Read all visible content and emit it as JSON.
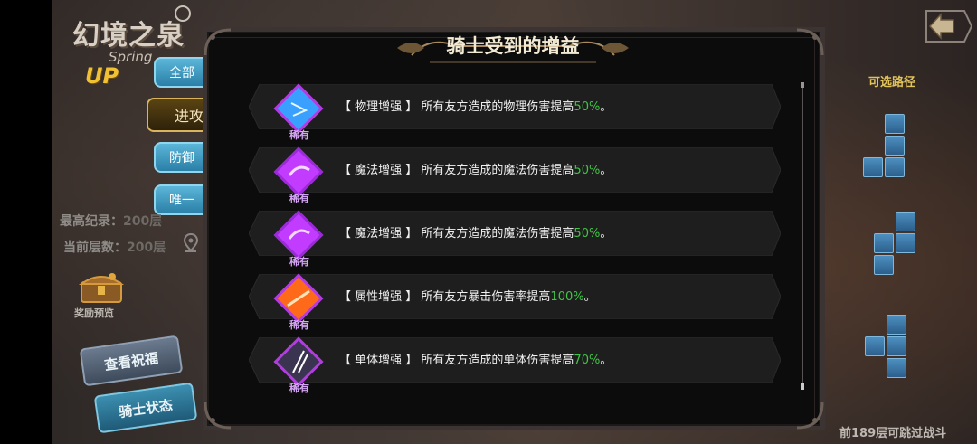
{
  "logo": {
    "title_cn": "幻境之泉",
    "title_en": "Spring",
    "badge": "UP"
  },
  "filter_tabs": [
    {
      "label": "全部"
    },
    {
      "label": "进攻"
    },
    {
      "label": "防御"
    },
    {
      "label": "唯一"
    }
  ],
  "stats": {
    "best_label": "最高纪录：",
    "best_value": "200层",
    "current_label": "当前层数：",
    "current_value": "200层"
  },
  "reward_preview": "奖励预览",
  "buttons": {
    "view_blessing": "查看祝福",
    "knight_status": "骑士状态"
  },
  "right_panel": {
    "path_title": "可选路径",
    "footer_note": "前189层可跳过战斗"
  },
  "modal": {
    "title": "骑士受到的增益",
    "buffs": [
      {
        "name": "【 物理增强 】",
        "desc": "所有友方造成的物理伤害提高",
        "pct": "50%",
        "end": "。",
        "rarity": "稀有",
        "icon": "physical-boost-icon",
        "color": "#3aa0ff"
      },
      {
        "name": "【 魔法增强 】",
        "desc": "所有友方造成的魔法伤害提高",
        "pct": "50%",
        "end": "。",
        "rarity": "稀有",
        "icon": "magic-boost-icon",
        "color": "#c23cff"
      },
      {
        "name": "【 魔法增强 】",
        "desc": "所有友方造成的魔法伤害提高",
        "pct": "50%",
        "end": "。",
        "rarity": "稀有",
        "icon": "magic-boost-icon",
        "color": "#c23cff"
      },
      {
        "name": "【 属性增强 】",
        "desc": "所有友方暴击伤害率提高",
        "pct": "100%",
        "end": "。",
        "rarity": "稀有",
        "icon": "attribute-boost-icon",
        "color": "#ff6a1a"
      },
      {
        "name": "【 单体增强 】",
        "desc": "所有友方造成的单体伤害提高",
        "pct": "70%",
        "end": "。",
        "rarity": "稀有",
        "icon": "single-target-boost-icon",
        "color": "#8a7aa8"
      }
    ]
  },
  "colors": {
    "accent_green": "#3fc645",
    "gold": "#e2c35a",
    "rarity_purple": "#b13ce0"
  }
}
